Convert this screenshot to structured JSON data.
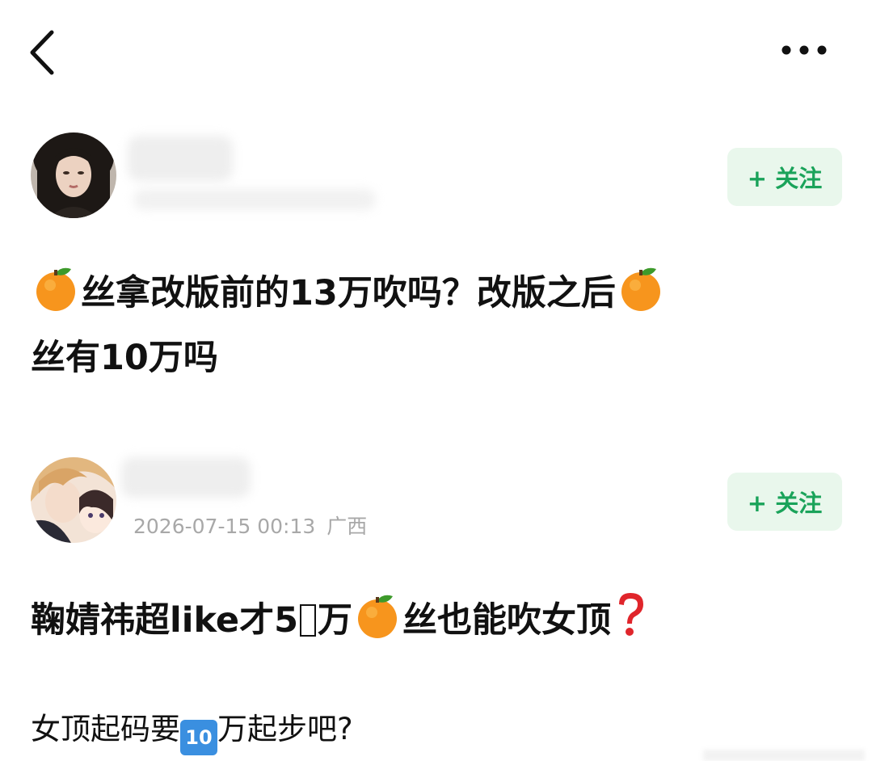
{
  "nav": {
    "back_icon": "chevron-left-icon",
    "more_icon": "more-horizontal-icon"
  },
  "post1": {
    "follow_label": "+ 关注",
    "text_parts": {
      "a": "丝拿改版前的13万吹吗？改版之后",
      "b": "丝有10万吗"
    }
  },
  "post2": {
    "timestamp": "2026-07-15 00:13",
    "location": "广西",
    "follow_label": "+ 关注",
    "text_parts": {
      "a": "鞠婧祎超like才5",
      "b": "万",
      "c": "丝也能吹女顶"
    },
    "sub_parts": {
      "a": "女顶起码要",
      "keycap": "10",
      "b": "万起步吧?"
    }
  },
  "icons": {
    "orange": "tangerine-emoji-icon",
    "question": "red-question-mark-icon",
    "keycap": "keycap-ten-icon"
  },
  "colors": {
    "follow_text": "#1aa35a",
    "follow_bg": "#e9f7ec",
    "meta_text": "#a8a8a8"
  }
}
